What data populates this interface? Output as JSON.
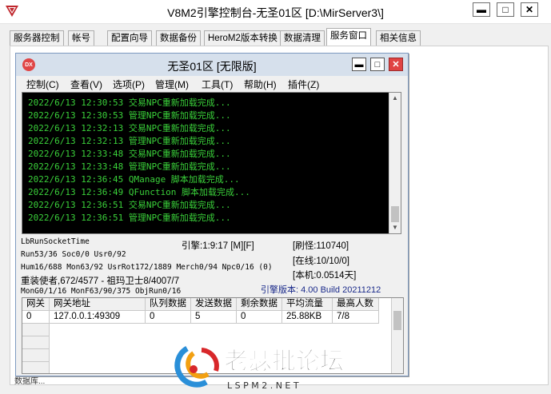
{
  "window": {
    "title": "V8M2引擎控制台-无圣01区 [D:\\MirServer3\\]",
    "minimize": "▬",
    "maximize": "□",
    "close": "✕"
  },
  "tabs": [
    "服务器控制",
    "帐号",
    "配置向导",
    "数据备份",
    "HeroM2版本转换",
    "数据清理",
    "服务窗口",
    "相关信息"
  ],
  "active_tab": "服务窗口",
  "inner": {
    "title": "无圣01区 [无限版]",
    "logo_text": "DX",
    "menu": [
      "控制(C)",
      "查看(V)",
      "选项(P)",
      "管理(M)",
      "工具(T)",
      "帮助(H)",
      "插件(Z)"
    ],
    "log_lines": [
      "2022/6/13 12:30:53 交易NPC重新加载完成...",
      "2022/6/13 12:30:53 管理NPC重新加载完成...",
      "2022/6/13 12:32:13 交易NPC重新加载完成...",
      "2022/6/13 12:32:13 管理NPC重新加载完成...",
      "2022/6/13 12:33:48 交易NPC重新加载完成...",
      "2022/6/13 12:33:48 管理NPC重新加载完成...",
      "2022/6/13 12:36:45 QManage 脚本加载完成...",
      "2022/6/13 12:36:49 QFunction 脚本加载完成...",
      "2022/6/13 12:36:51 交易NPC重新加载完成...",
      "2022/6/13 12:36:51 管理NPC重新加载完成..."
    ],
    "status": {
      "run_socket": "LbRunSocketTime",
      "run": "Run53/36 Soc0/0 Usr0/92",
      "hum": "Hum16/688 Mon63/92 UsrRot172/1889 Merch0/94 Npc0/16 (0)",
      "boss": "重装使者,672/4577 - 祖玛卫士8/4007/7",
      "mong": "MonG0/1/16 MonF63/90/375 ObjRun0/16",
      "engine_time": "引擎:1:9:17 [M][F]",
      "refresh": "[刷怪:110740]",
      "online": "[在线:10/10/0]",
      "local": "[本机:0.0514天]",
      "version": "引擎版本: 4.00 Build 20211212"
    },
    "grid": {
      "headers": [
        "网关",
        "网关地址",
        "队列数据",
        "发送数据",
        "剩余数据",
        "平均流量",
        "最高人数"
      ],
      "rows": [
        [
          "0",
          "127.0.0.1:49309",
          "0",
          "5",
          "0",
          "25.88KB",
          "7/8"
        ]
      ]
    }
  },
  "bottom_strip": "数据库...",
  "watermark": {
    "text": "老瑟批论坛",
    "sub": "L S P M 2 . N E T"
  }
}
